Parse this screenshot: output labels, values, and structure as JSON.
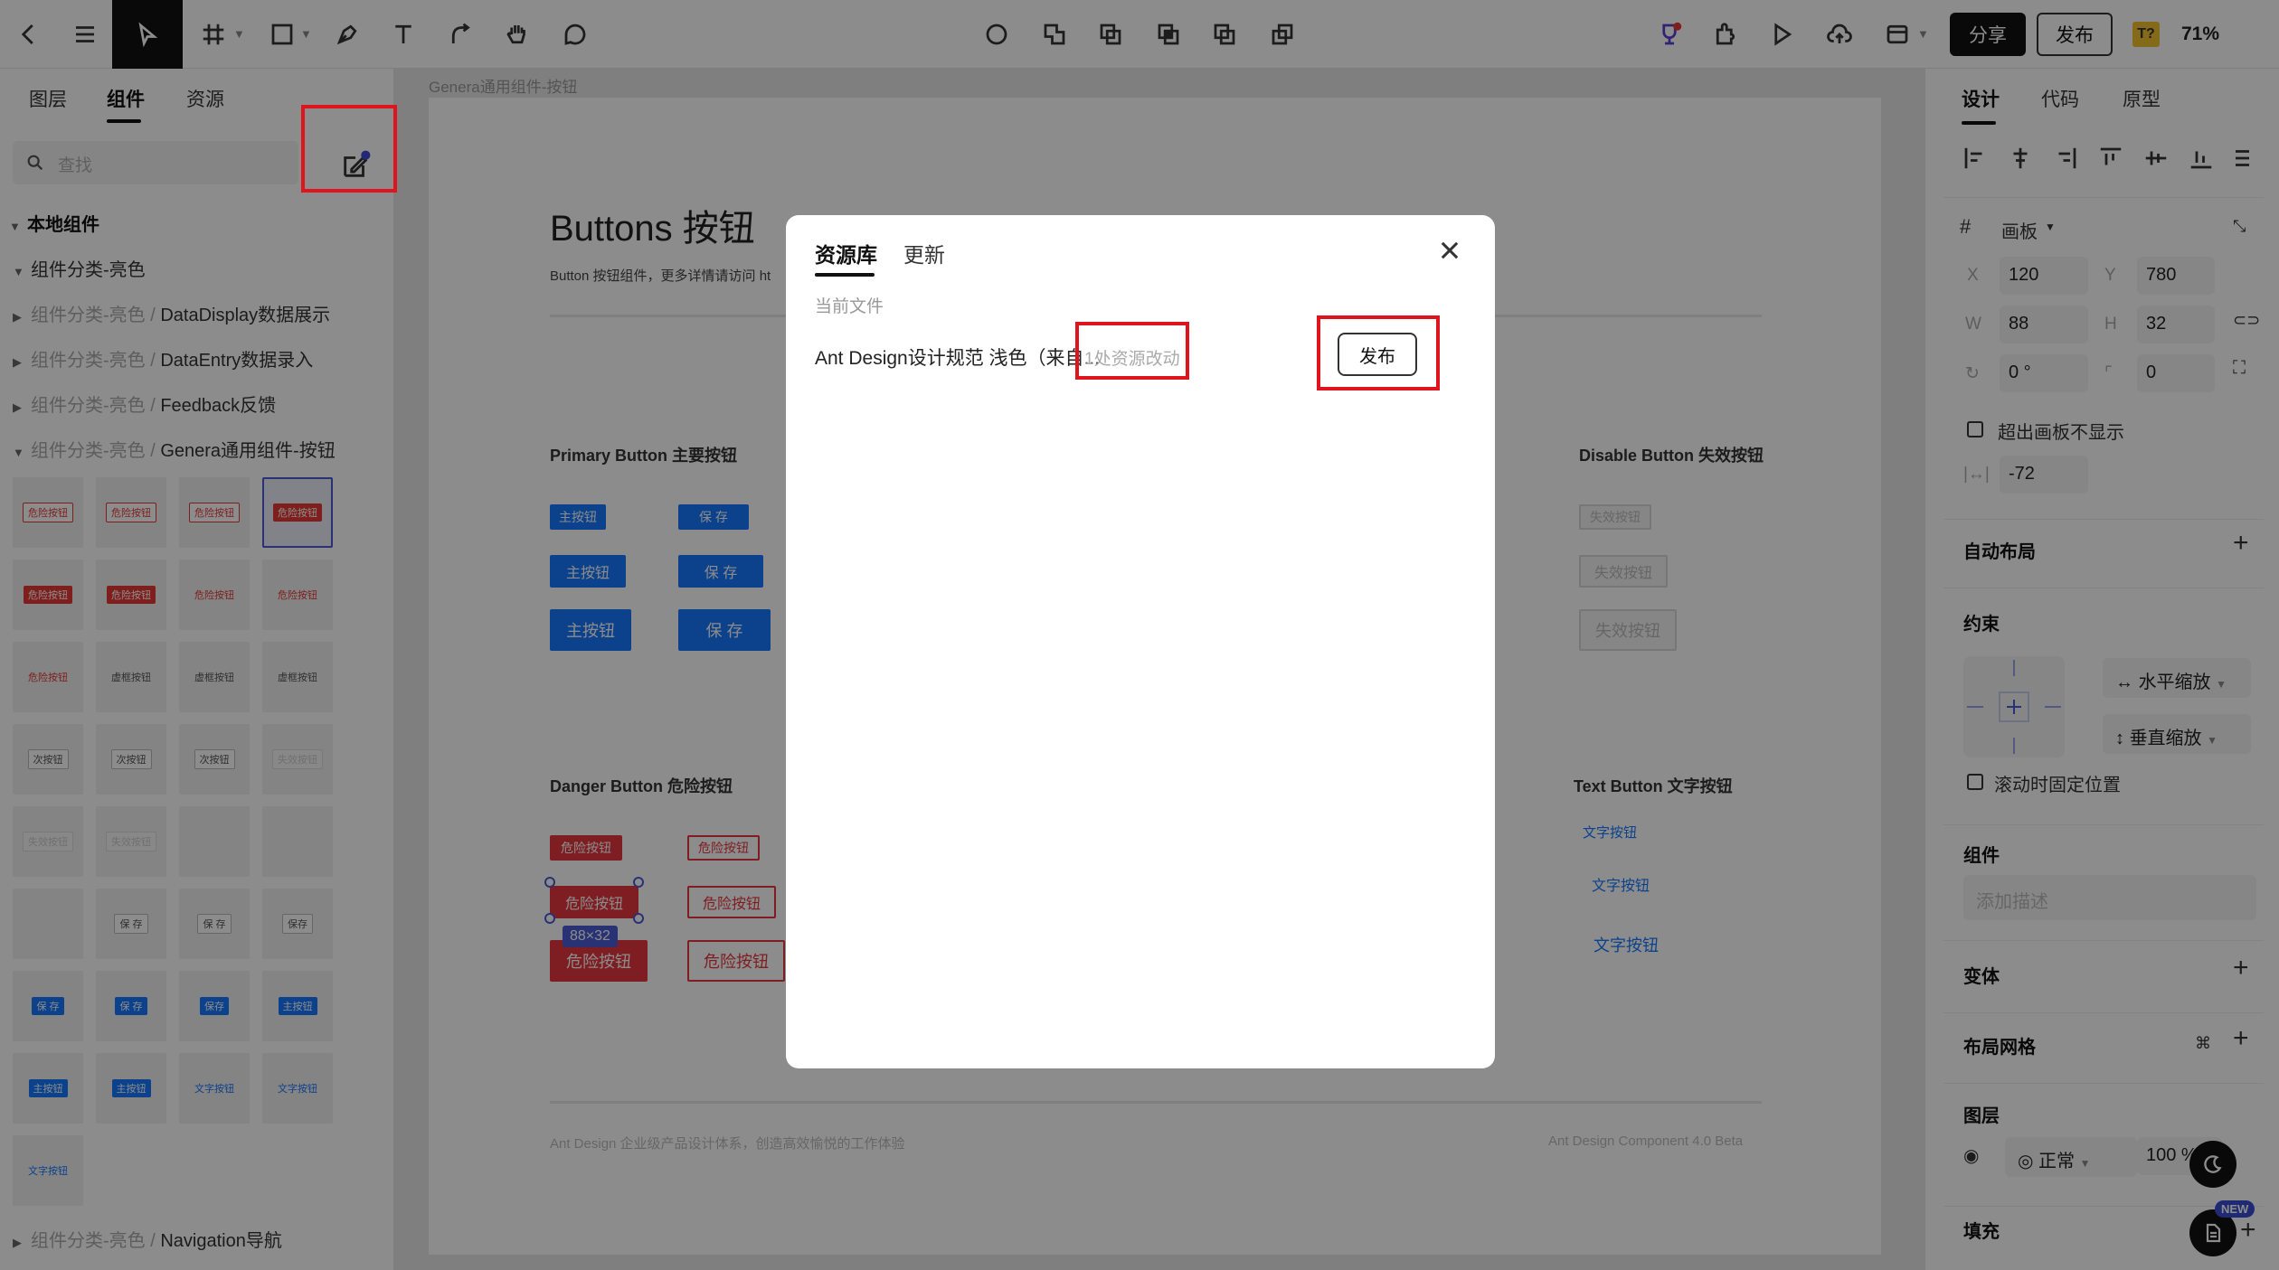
{
  "toolbar": {
    "share_label": "分享",
    "publish_label": "发布",
    "avatar_text": "T?",
    "zoom": "71%"
  },
  "left_panel": {
    "tabs": [
      "图层",
      "组件",
      "资源"
    ],
    "active_tab": "组件",
    "search_placeholder": "查找",
    "tree": {
      "root": "本地组件",
      "group": "组件分类-亮色",
      "items": [
        {
          "prefix": "组件分类-亮色 / ",
          "name": "DataDisplay数据展示"
        },
        {
          "prefix": "组件分类-亮色 / ",
          "name": "DataEntry数据录入"
        },
        {
          "prefix": "组件分类-亮色 / ",
          "name": "Feedback反馈"
        },
        {
          "prefix": "组件分类-亮色 / ",
          "name": "Genera通用组件-按钮"
        },
        {
          "prefix": "组件分类-亮色 / ",
          "name": "Navigation导航"
        }
      ]
    },
    "thumbs": [
      {
        "text": "危险按钮",
        "style": "redo"
      },
      {
        "text": "危险按钮",
        "style": "redo"
      },
      {
        "text": "危险按钮",
        "style": "redo"
      },
      {
        "text": "危险按钮",
        "style": "red"
      },
      {
        "text": "危险按钮",
        "style": "red"
      },
      {
        "text": "危险按钮",
        "style": "red"
      },
      {
        "text": "危险按钮",
        "style": "txtred"
      },
      {
        "text": "危险按钮",
        "style": "txtred"
      },
      {
        "text": "危险按钮",
        "style": "txtred"
      },
      {
        "text": "虚框按钮",
        "style": "plain"
      },
      {
        "text": "虚框按钮",
        "style": "plain"
      },
      {
        "text": "虚框按钮",
        "style": "plain"
      },
      {
        "text": "次按钮",
        "style": "grey"
      },
      {
        "text": "次按钮",
        "style": "grey"
      },
      {
        "text": "次按钮",
        "style": "grey"
      },
      {
        "text": "失效按钮",
        "style": "dis"
      },
      {
        "text": "失效按钮",
        "style": "dis"
      },
      {
        "text": "失效按钮",
        "style": "dis"
      },
      {
        "text": "",
        "style": "empty"
      },
      {
        "text": "",
        "style": "empty"
      },
      {
        "text": "",
        "style": "empty"
      },
      {
        "text": "保 存",
        "style": "grey"
      },
      {
        "text": "保 存",
        "style": "grey"
      },
      {
        "text": "保存",
        "style": "grey"
      },
      {
        "text": "保 存",
        "style": "blue"
      },
      {
        "text": "保 存",
        "style": "blue"
      },
      {
        "text": "保存",
        "style": "blue"
      },
      {
        "text": "主按钮",
        "style": "blue"
      },
      {
        "text": "主按钮",
        "style": "blue"
      },
      {
        "text": "主按钮",
        "style": "blue"
      },
      {
        "text": "文字按钮",
        "style": "txt"
      },
      {
        "text": "文字按钮",
        "style": "txt"
      },
      {
        "text": "文字按钮",
        "style": "txt"
      }
    ]
  },
  "canvas": {
    "frame_label": "Genera通用组件-按钮",
    "title": "Buttons 按钮",
    "subtitle": "Button 按钮组件，更多详情请访问 ht",
    "sections": {
      "primary": "Primary Button 主要按钮",
      "disable": "Disable Button 失效按钮",
      "danger": "Danger Button 危险按钮",
      "text": "Text Button 文字按钮"
    },
    "buttons": {
      "primary": "主按钮",
      "save": "保 存",
      "disabled": "失效按钮",
      "danger": "危险按钮",
      "text": "文字按钮"
    },
    "selection_size": "88×32",
    "footer_left": "Ant Design 企业级产品设计体系，创造高效愉悦的工作体验",
    "footer_right": "Ant Design Component 4.0 Beta"
  },
  "modal": {
    "tabs": [
      "资源库",
      "更新"
    ],
    "active_tab": "资源库",
    "section_label": "当前文件",
    "library_name": "Ant Design设计规范 浅色（来自...",
    "change_count": "1处资源改动",
    "publish_label": "发布"
  },
  "right_panel": {
    "tabs": [
      "设计",
      "代码",
      "原型"
    ],
    "active_tab": "设计",
    "frame_label": "画板",
    "x": "120",
    "y": "780",
    "w": "88",
    "h": "32",
    "rotation": "0 °",
    "radius": "0",
    "clip_label": "超出画板不显示",
    "spacing": "-72",
    "auto_layout": "自动布局",
    "constraints": "约束",
    "h_constraint": "水平缩放",
    "v_constraint": "垂直缩放",
    "fix_scroll": "滚动时固定位置",
    "component_label": "组件",
    "desc_placeholder": "添加描述",
    "variant": "变体",
    "layout_grid": "布局网格",
    "layer": "图层",
    "blend": "正常",
    "opacity": "100 %",
    "fill": "填充",
    "new_badge": "NEW"
  },
  "colors": {
    "primary": "#1677ff",
    "danger": "#e5383e",
    "accent": "#4a5bd4",
    "highlight": "#e0141e"
  }
}
